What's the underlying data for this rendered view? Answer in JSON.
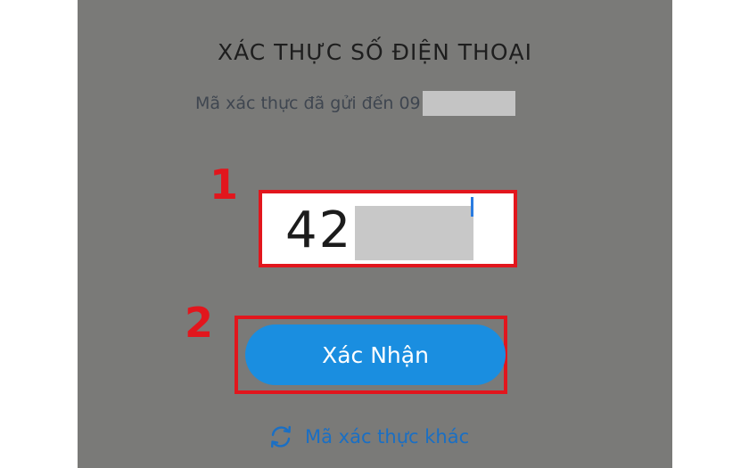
{
  "screen": {
    "title": "XÁC THỰC SỐ ĐIỆN THOẠI",
    "subtitle_prefix": "Mã xác thực đã gửi đến 09"
  },
  "annotations": {
    "marker_1": "1",
    "marker_2": "2",
    "highlight_color": "#e2161d"
  },
  "code_input": {
    "visible_value": "428"
  },
  "confirm_button": {
    "label": "Xác Nhận",
    "color": "#1a8ee0"
  },
  "other_code_link": {
    "label": "Mã xác thực khác",
    "icon": "refresh-icon",
    "color": "#1a6fc4"
  }
}
